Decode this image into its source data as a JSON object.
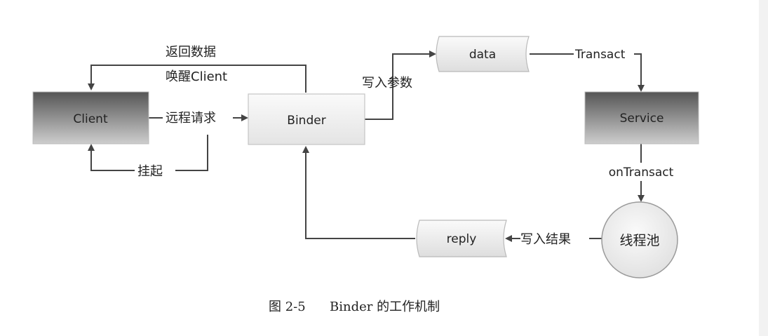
{
  "nodes": {
    "client": "Client",
    "binder": "Binder",
    "data": "data",
    "service": "Service",
    "thread_pool": "线程池",
    "reply": "reply"
  },
  "edges": {
    "return_data": "返回数据",
    "wake_client": "唤醒Client",
    "remote_request": "远程请求",
    "suspend": "挂起",
    "write_params": "写入参数",
    "transact": "Transact",
    "on_transact": "onTransact",
    "write_result": "写入结果"
  },
  "caption": {
    "label": "图 2-5",
    "text": "Binder 的工作机制"
  },
  "colors": {
    "dark_box_top": "#595959",
    "dark_box_bottom": "#c8c8c8",
    "light_box": "#efefef",
    "line": "#444444"
  }
}
